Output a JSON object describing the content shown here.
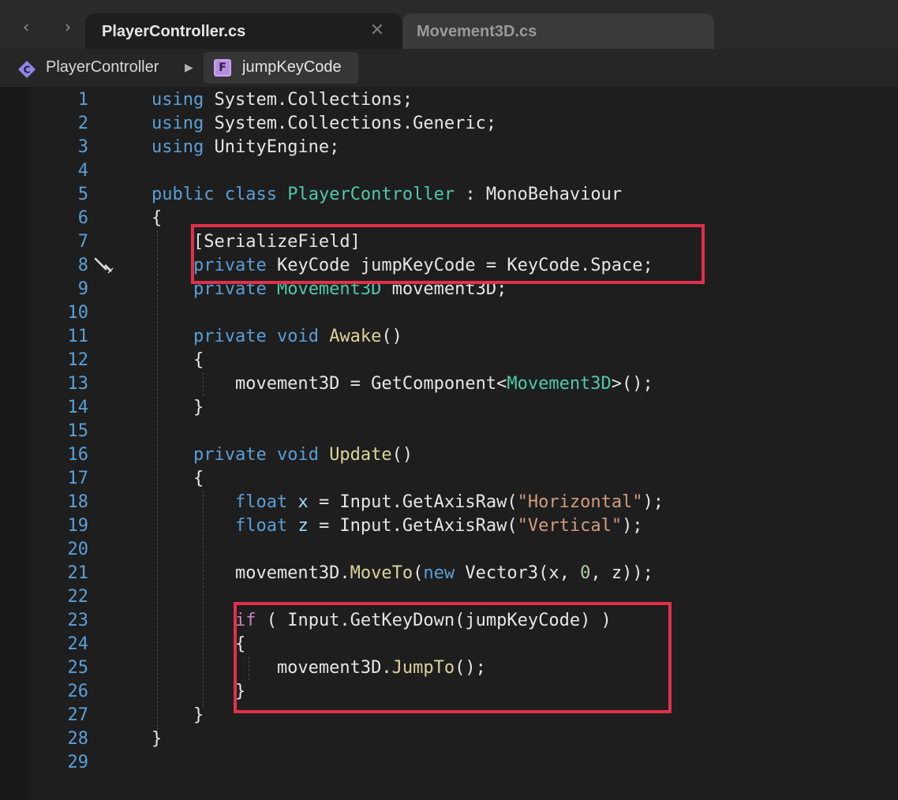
{
  "tabs": {
    "active_label": "PlayerController.cs",
    "inactive_label": "Movement3D.cs"
  },
  "breadcrumb": {
    "class_name": "PlayerController",
    "class_icon_letter": "C",
    "field_name": "jumpKeyCode",
    "field_icon_letter": "F"
  },
  "icons": {
    "back": "chevron-left-icon",
    "forward": "chevron-right-icon",
    "close": "close-icon"
  },
  "colors": {
    "keyword": "#5a9fd6",
    "type": "#4ec9a8",
    "function": "#dcd49a",
    "string": "#d39c7c",
    "highlight_box": "#e1304a",
    "line_number": "#5aa0d8"
  },
  "lines": [
    [
      {
        "t": "using",
        "c": "kw"
      },
      {
        "t": " System.Collections;"
      }
    ],
    [
      {
        "t": "using",
        "c": "kw"
      },
      {
        "t": " System.Collections.Generic;"
      }
    ],
    [
      {
        "t": "using",
        "c": "kw"
      },
      {
        "t": " UnityEngine;"
      }
    ],
    [],
    [
      {
        "t": "public",
        "c": "kw"
      },
      {
        "t": " "
      },
      {
        "t": "class",
        "c": "kw"
      },
      {
        "t": " "
      },
      {
        "t": "PlayerController",
        "c": "ty"
      },
      {
        "t": " : MonoBehaviour"
      }
    ],
    [
      {
        "t": "{"
      }
    ],
    [
      {
        "t": "    [SerializeField]"
      }
    ],
    [
      {
        "t": "    "
      },
      {
        "t": "private",
        "c": "kw"
      },
      {
        "t": " KeyCode jumpKeyCode = KeyCode.Space;"
      }
    ],
    [
      {
        "t": "    "
      },
      {
        "t": "private",
        "c": "kw"
      },
      {
        "t": " "
      },
      {
        "t": "Movement3D",
        "c": "ty"
      },
      {
        "t": " movement3D;"
      }
    ],
    [],
    [
      {
        "t": "    "
      },
      {
        "t": "private",
        "c": "kw"
      },
      {
        "t": " "
      },
      {
        "t": "void",
        "c": "kw"
      },
      {
        "t": " "
      },
      {
        "t": "Awake",
        "c": "fn"
      },
      {
        "t": "()"
      }
    ],
    [
      {
        "t": "    {"
      }
    ],
    [
      {
        "t": "        movement3D = GetComponent<"
      },
      {
        "t": "Movement3D",
        "c": "ty"
      },
      {
        "t": ">();"
      }
    ],
    [
      {
        "t": "    }"
      }
    ],
    [],
    [
      {
        "t": "    "
      },
      {
        "t": "private",
        "c": "kw"
      },
      {
        "t": " "
      },
      {
        "t": "void",
        "c": "kw"
      },
      {
        "t": " "
      },
      {
        "t": "Update",
        "c": "fn"
      },
      {
        "t": "()"
      }
    ],
    [
      {
        "t": "    {"
      }
    ],
    [
      {
        "t": "        "
      },
      {
        "t": "float",
        "c": "kw"
      },
      {
        "t": " "
      },
      {
        "t": "x",
        "c": "vr"
      },
      {
        "t": " = Input.GetAxisRaw("
      },
      {
        "t": "\"Horizontal\"",
        "c": "st"
      },
      {
        "t": ");"
      }
    ],
    [
      {
        "t": "        "
      },
      {
        "t": "float",
        "c": "kw"
      },
      {
        "t": " "
      },
      {
        "t": "z",
        "c": "vr"
      },
      {
        "t": " = Input.GetAxisRaw("
      },
      {
        "t": "\"Vertical\"",
        "c": "st"
      },
      {
        "t": ");"
      }
    ],
    [],
    [
      {
        "t": "        movement3D."
      },
      {
        "t": "MoveTo",
        "c": "fn"
      },
      {
        "t": "("
      },
      {
        "t": "new",
        "c": "kw"
      },
      {
        "t": " Vector3(x, "
      },
      {
        "t": "0",
        "c": "nm"
      },
      {
        "t": ", z));"
      }
    ],
    [],
    [
      {
        "t": "        "
      },
      {
        "t": "if",
        "c": "ct"
      },
      {
        "t": " ( Input.GetKeyDown(jumpKeyCode) )"
      }
    ],
    [
      {
        "t": "        {"
      }
    ],
    [
      {
        "t": "            movement3D."
      },
      {
        "t": "JumpTo",
        "c": "fn"
      },
      {
        "t": "();"
      }
    ],
    [
      {
        "t": "        }"
      }
    ],
    [
      {
        "t": "    }"
      }
    ],
    [
      {
        "t": "}"
      }
    ],
    []
  ]
}
